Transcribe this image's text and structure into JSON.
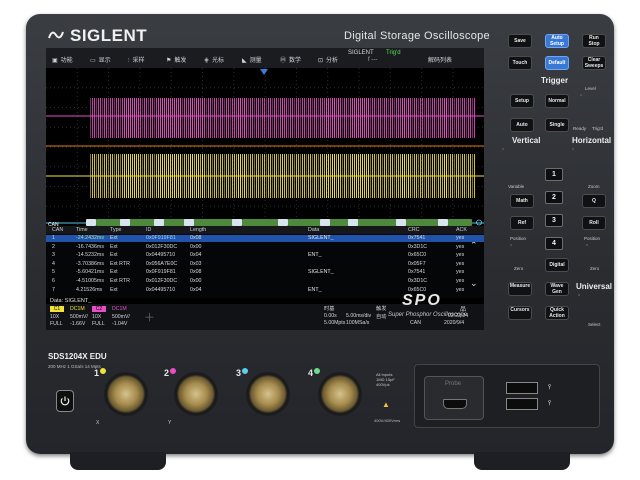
{
  "brand": {
    "name": "SIGLENT",
    "product_title": "Digital Storage Oscilloscope"
  },
  "menu": [
    {
      "label": "功能",
      "icon": "function-icon"
    },
    {
      "label": "显示",
      "icon": "display-icon"
    },
    {
      "label": "采样",
      "icon": "sample-icon"
    },
    {
      "label": "触发",
      "icon": "trigger-icon"
    },
    {
      "label": "光标",
      "icon": "cursor-icon"
    },
    {
      "label": "测量",
      "icon": "measure-icon"
    },
    {
      "label": "数学",
      "icon": "math-icon"
    },
    {
      "label": "分析",
      "icon": "analysis-icon"
    }
  ],
  "status": {
    "logo": "SIGLENT",
    "trig_state": "Trig'd",
    "trig_sub": "f ---",
    "decode_label": "解码列表"
  },
  "decode_tag": "CAN",
  "table": {
    "headers": [
      "CAN",
      "Time",
      "Type",
      "ID",
      "Length",
      "Data",
      "CRC",
      "ACK"
    ],
    "rows": [
      [
        "1",
        "-24.2432ms",
        "Ext",
        "0x0F919F81",
        "0x08",
        "SIGLENT_",
        "0x7541",
        "yes"
      ],
      [
        "2",
        "-16.7436ms",
        "Ext",
        "0x012F30DC",
        "0x00",
        "",
        "0x3D1C",
        "yes"
      ],
      [
        "3",
        "-14.5232ms",
        "Ext",
        "0x04495710",
        "0x04",
        "ENT_",
        "0x65C0",
        "yes"
      ],
      [
        "4",
        "-3.70386ms",
        "Ext RTR",
        "0x056A7E0C",
        "0x03",
        "",
        "0x05F7",
        "yes"
      ],
      [
        "5",
        "-5.60421ms",
        "Ext",
        "0x0F919F81",
        "0x08",
        "SIGLENT_",
        "0x7541",
        "yes"
      ],
      [
        "6",
        "-4.51005ms",
        "Ext RTR",
        "0x012F30DC",
        "0x00",
        "",
        "0x3D1C",
        "yes"
      ],
      [
        "7",
        "4.21526ms",
        "Ext",
        "0x04495710",
        "0x04",
        "ENT_",
        "0x65C0",
        "yes"
      ]
    ],
    "data_line": "Data: SIGLENT_"
  },
  "channels": [
    {
      "label": "C1",
      "color": "#f2e23a",
      "coupling": "DC1M",
      "probe": "10X",
      "scale": "500mV/",
      "bw": "FULL",
      "offset": "-1.66V"
    },
    {
      "label": "C2",
      "color": "#e84fc6",
      "coupling": "DC1M",
      "probe": "10X",
      "scale": "500mV/",
      "bw": "FULL",
      "offset": "-1.04V"
    }
  ],
  "timebase": {
    "title": "时基",
    "delay": "0.00s",
    "scale": "5.00ms/div",
    "mem": "5.00Mpts",
    "rate": "100MSa/s",
    "trigger_title": "触发",
    "edge": "自动",
    "src": "CAN",
    "time": "02:22:24",
    "date": "2020/9/4"
  },
  "spo": {
    "big": "SPO",
    "sub": "Super Phosphor Oscilloscope"
  },
  "panel": {
    "top_buttons": [
      "Save",
      "Auto Setup",
      "Run Stop",
      "Touch",
      "Default",
      "Clear Sweeps"
    ],
    "trigger_title": "Trigger",
    "trigger_buttons": [
      "Setup",
      "Normal",
      "Auto",
      "Single"
    ],
    "level_label": "Level",
    "led_labels": [
      "Ready",
      "Trig'd"
    ],
    "vertical_title": "Vertical",
    "horizontal_title": "Horizontal",
    "vertical_buttons": [
      "Math",
      "Ref",
      "Digital"
    ],
    "channel_numbers": [
      "1",
      "2",
      "3",
      "4"
    ],
    "horizontal_buttons": [
      "Q",
      "Roll"
    ],
    "knob_labels": [
      "Variable",
      "Position",
      "Zero",
      "Position",
      "Zero",
      "Zoom",
      "Select"
    ],
    "bottom_buttons": [
      "Measure",
      "Wave Gen",
      "Cursors",
      "Quick Action"
    ],
    "universal_title": "Universal"
  },
  "front": {
    "model": "SDS1204X EDU",
    "spec": "200 MHz  1 GSa/s  14 Mpts",
    "channel_numbers": [
      "1",
      "2",
      "3",
      "4"
    ],
    "bnc_colors": [
      "#f2e23a",
      "#e84fc6",
      "#5bd0ea",
      "#6fdc8a"
    ],
    "bottom_letters": [
      "X",
      "Y"
    ],
    "warning_text": [
      "All Inputs",
      "1MΩ 15pF",
      "400Vpk"
    ],
    "sub_warning": "400V/400Vrms",
    "probe_label": "Probe"
  }
}
